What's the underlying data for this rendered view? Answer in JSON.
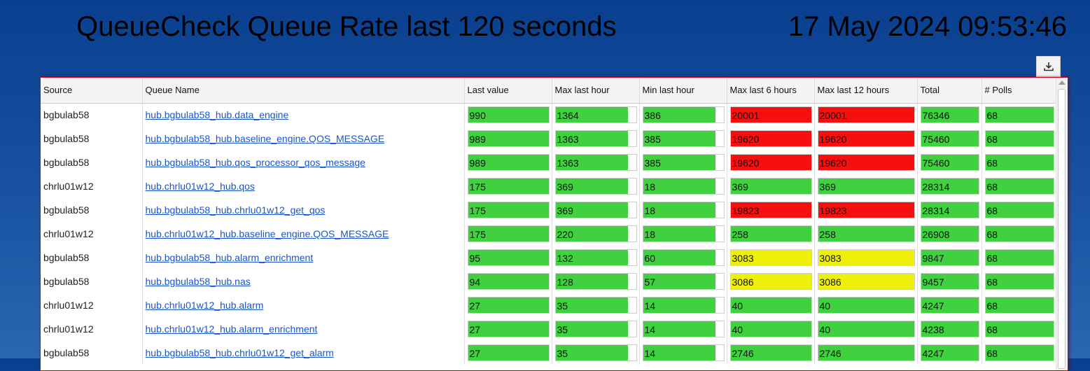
{
  "header": {
    "title": "QueueCheck Queue Rate last 120 seconds",
    "datetime": "17 May 2024 09:53:46"
  },
  "toolbar": {
    "download_icon": "download-icon"
  },
  "colors": {
    "green": "#40d040",
    "red": "#f50f0f",
    "yellow": "#eef00a",
    "accent_border": "#d0021b"
  },
  "table": {
    "columns": [
      "Source",
      "Queue Name",
      "Last value",
      "Max last hour",
      "Min last hour",
      "Max last 6 hours",
      "Max last 12 hours",
      "Total",
      "# Polls"
    ],
    "rows": [
      {
        "source": "bgbulab58",
        "queue": "hub.bgbulab58_hub.data_engine",
        "last": "990",
        "maxh": "1364",
        "minh": "386",
        "max6": "20001",
        "max12": "20001",
        "total": "76346",
        "polls": "68",
        "c6": "red",
        "c12": "red",
        "lastFill": 1,
        "maxhFill": 0.9,
        "minhFill": 0.9,
        "max6Fill": 1,
        "max12Fill": 1
      },
      {
        "source": "bgbulab58",
        "queue": "hub.bgbulab58_hub.baseline_engine.QOS_MESSAGE",
        "last": "989",
        "maxh": "1363",
        "minh": "385",
        "max6": "19620",
        "max12": "19620",
        "total": "75460",
        "polls": "68",
        "c6": "red",
        "c12": "red",
        "lastFill": 1,
        "maxhFill": 0.9,
        "minhFill": 0.9,
        "max6Fill": 1,
        "max12Fill": 1
      },
      {
        "source": "bgbulab58",
        "queue": "hub.bgbulab58_hub.qos_processor_qos_message",
        "last": "989",
        "maxh": "1363",
        "minh": "385",
        "max6": "19620",
        "max12": "19620",
        "total": "75460",
        "polls": "68",
        "c6": "red",
        "c12": "red",
        "lastFill": 1,
        "maxhFill": 0.9,
        "minhFill": 0.9,
        "max6Fill": 1,
        "max12Fill": 1
      },
      {
        "source": "chrlu01w12",
        "queue": "hub.chrlu01w12_hub.qos",
        "last": "175",
        "maxh": "369",
        "minh": "18",
        "max6": "369",
        "max12": "369",
        "total": "28314",
        "polls": "68",
        "c6": "green",
        "c12": "green",
        "lastFill": 1,
        "maxhFill": 0.9,
        "minhFill": 0.9,
        "max6Fill": 1,
        "max12Fill": 1
      },
      {
        "source": "bgbulab58",
        "queue": "hub.bgbulab58_hub.chrlu01w12_get_qos",
        "last": "175",
        "maxh": "369",
        "minh": "18",
        "max6": "19823",
        "max12": "19823",
        "total": "28314",
        "polls": "68",
        "c6": "red",
        "c12": "red",
        "lastFill": 1,
        "maxhFill": 0.9,
        "minhFill": 0.9,
        "max6Fill": 1,
        "max12Fill": 1
      },
      {
        "source": "chrlu01w12",
        "queue": "hub.chrlu01w12_hub.baseline_engine.QOS_MESSAGE",
        "last": "175",
        "maxh": "220",
        "minh": "18",
        "max6": "258",
        "max12": "258",
        "total": "26908",
        "polls": "68",
        "c6": "green",
        "c12": "green",
        "lastFill": 1,
        "maxhFill": 0.9,
        "minhFill": 0.9,
        "max6Fill": 1,
        "max12Fill": 1
      },
      {
        "source": "bgbulab58",
        "queue": "hub.bgbulab58_hub.alarm_enrichment",
        "last": "95",
        "maxh": "132",
        "minh": "60",
        "max6": "3083",
        "max12": "3083",
        "total": "9847",
        "polls": "68",
        "c6": "yellow",
        "c12": "yellow",
        "lastFill": 1,
        "maxhFill": 0.9,
        "minhFill": 0.9,
        "max6Fill": 1,
        "max12Fill": 1
      },
      {
        "source": "bgbulab58",
        "queue": "hub.bgbulab58_hub.nas",
        "last": "94",
        "maxh": "128",
        "minh": "57",
        "max6": "3086",
        "max12": "3086",
        "total": "9457",
        "polls": "68",
        "c6": "yellow",
        "c12": "yellow",
        "lastFill": 1,
        "maxhFill": 0.9,
        "minhFill": 0.9,
        "max6Fill": 1,
        "max12Fill": 1
      },
      {
        "source": "chrlu01w12",
        "queue": "hub.chrlu01w12_hub.alarm",
        "last": "27",
        "maxh": "35",
        "minh": "14",
        "max6": "40",
        "max12": "40",
        "total": "4247",
        "polls": "68",
        "c6": "green",
        "c12": "green",
        "lastFill": 1,
        "maxhFill": 0.9,
        "minhFill": 0.9,
        "max6Fill": 1,
        "max12Fill": 1
      },
      {
        "source": "chrlu01w12",
        "queue": "hub.chrlu01w12_hub.alarm_enrichment",
        "last": "27",
        "maxh": "35",
        "minh": "14",
        "max6": "40",
        "max12": "40",
        "total": "4238",
        "polls": "68",
        "c6": "green",
        "c12": "green",
        "lastFill": 1,
        "maxhFill": 0.9,
        "minhFill": 0.9,
        "max6Fill": 1,
        "max12Fill": 1
      },
      {
        "source": "bgbulab58",
        "queue": "hub.bgbulab58_hub.chrlu01w12_get_alarm",
        "last": "27",
        "maxh": "35",
        "minh": "14",
        "max6": "2746",
        "max12": "2746",
        "total": "4247",
        "polls": "68",
        "c6": "green",
        "c12": "green",
        "lastFill": 1,
        "maxhFill": 0.9,
        "minhFill": 0.9,
        "max6Fill": 1,
        "max12Fill": 1
      }
    ]
  }
}
